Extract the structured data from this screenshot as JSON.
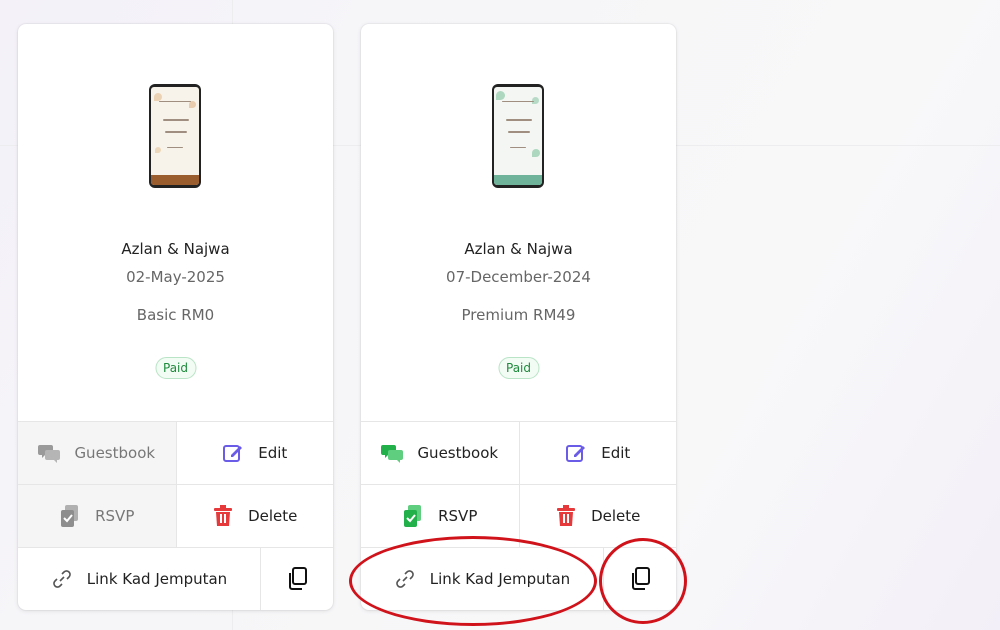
{
  "cards": [
    {
      "name": "Azlan & Najwa",
      "date": "02-May-2025",
      "plan": "Basic RM0",
      "status": "Paid",
      "guestbook_label": "Guestbook",
      "edit_label": "Edit",
      "rsvp_label": "RSVP",
      "delete_label": "Delete",
      "link_label": "Link Kad Jemputan",
      "guestbook_enabled": false,
      "rsvp_enabled": false
    },
    {
      "name": "Azlan & Najwa",
      "date": "07-December-2024",
      "plan": "Premium RM49",
      "status": "Paid",
      "guestbook_label": "Guestbook",
      "edit_label": "Edit",
      "rsvp_label": "RSVP",
      "delete_label": "Delete",
      "link_label": "Link Kad Jemputan",
      "guestbook_enabled": true,
      "rsvp_enabled": true
    }
  ],
  "colors": {
    "paid_green": "#1e8a3c",
    "edit_purple": "#6b5ce7",
    "delete_red": "#e5393b",
    "guestbook_green": "#22b04b",
    "highlight_red": "#d0121b"
  }
}
